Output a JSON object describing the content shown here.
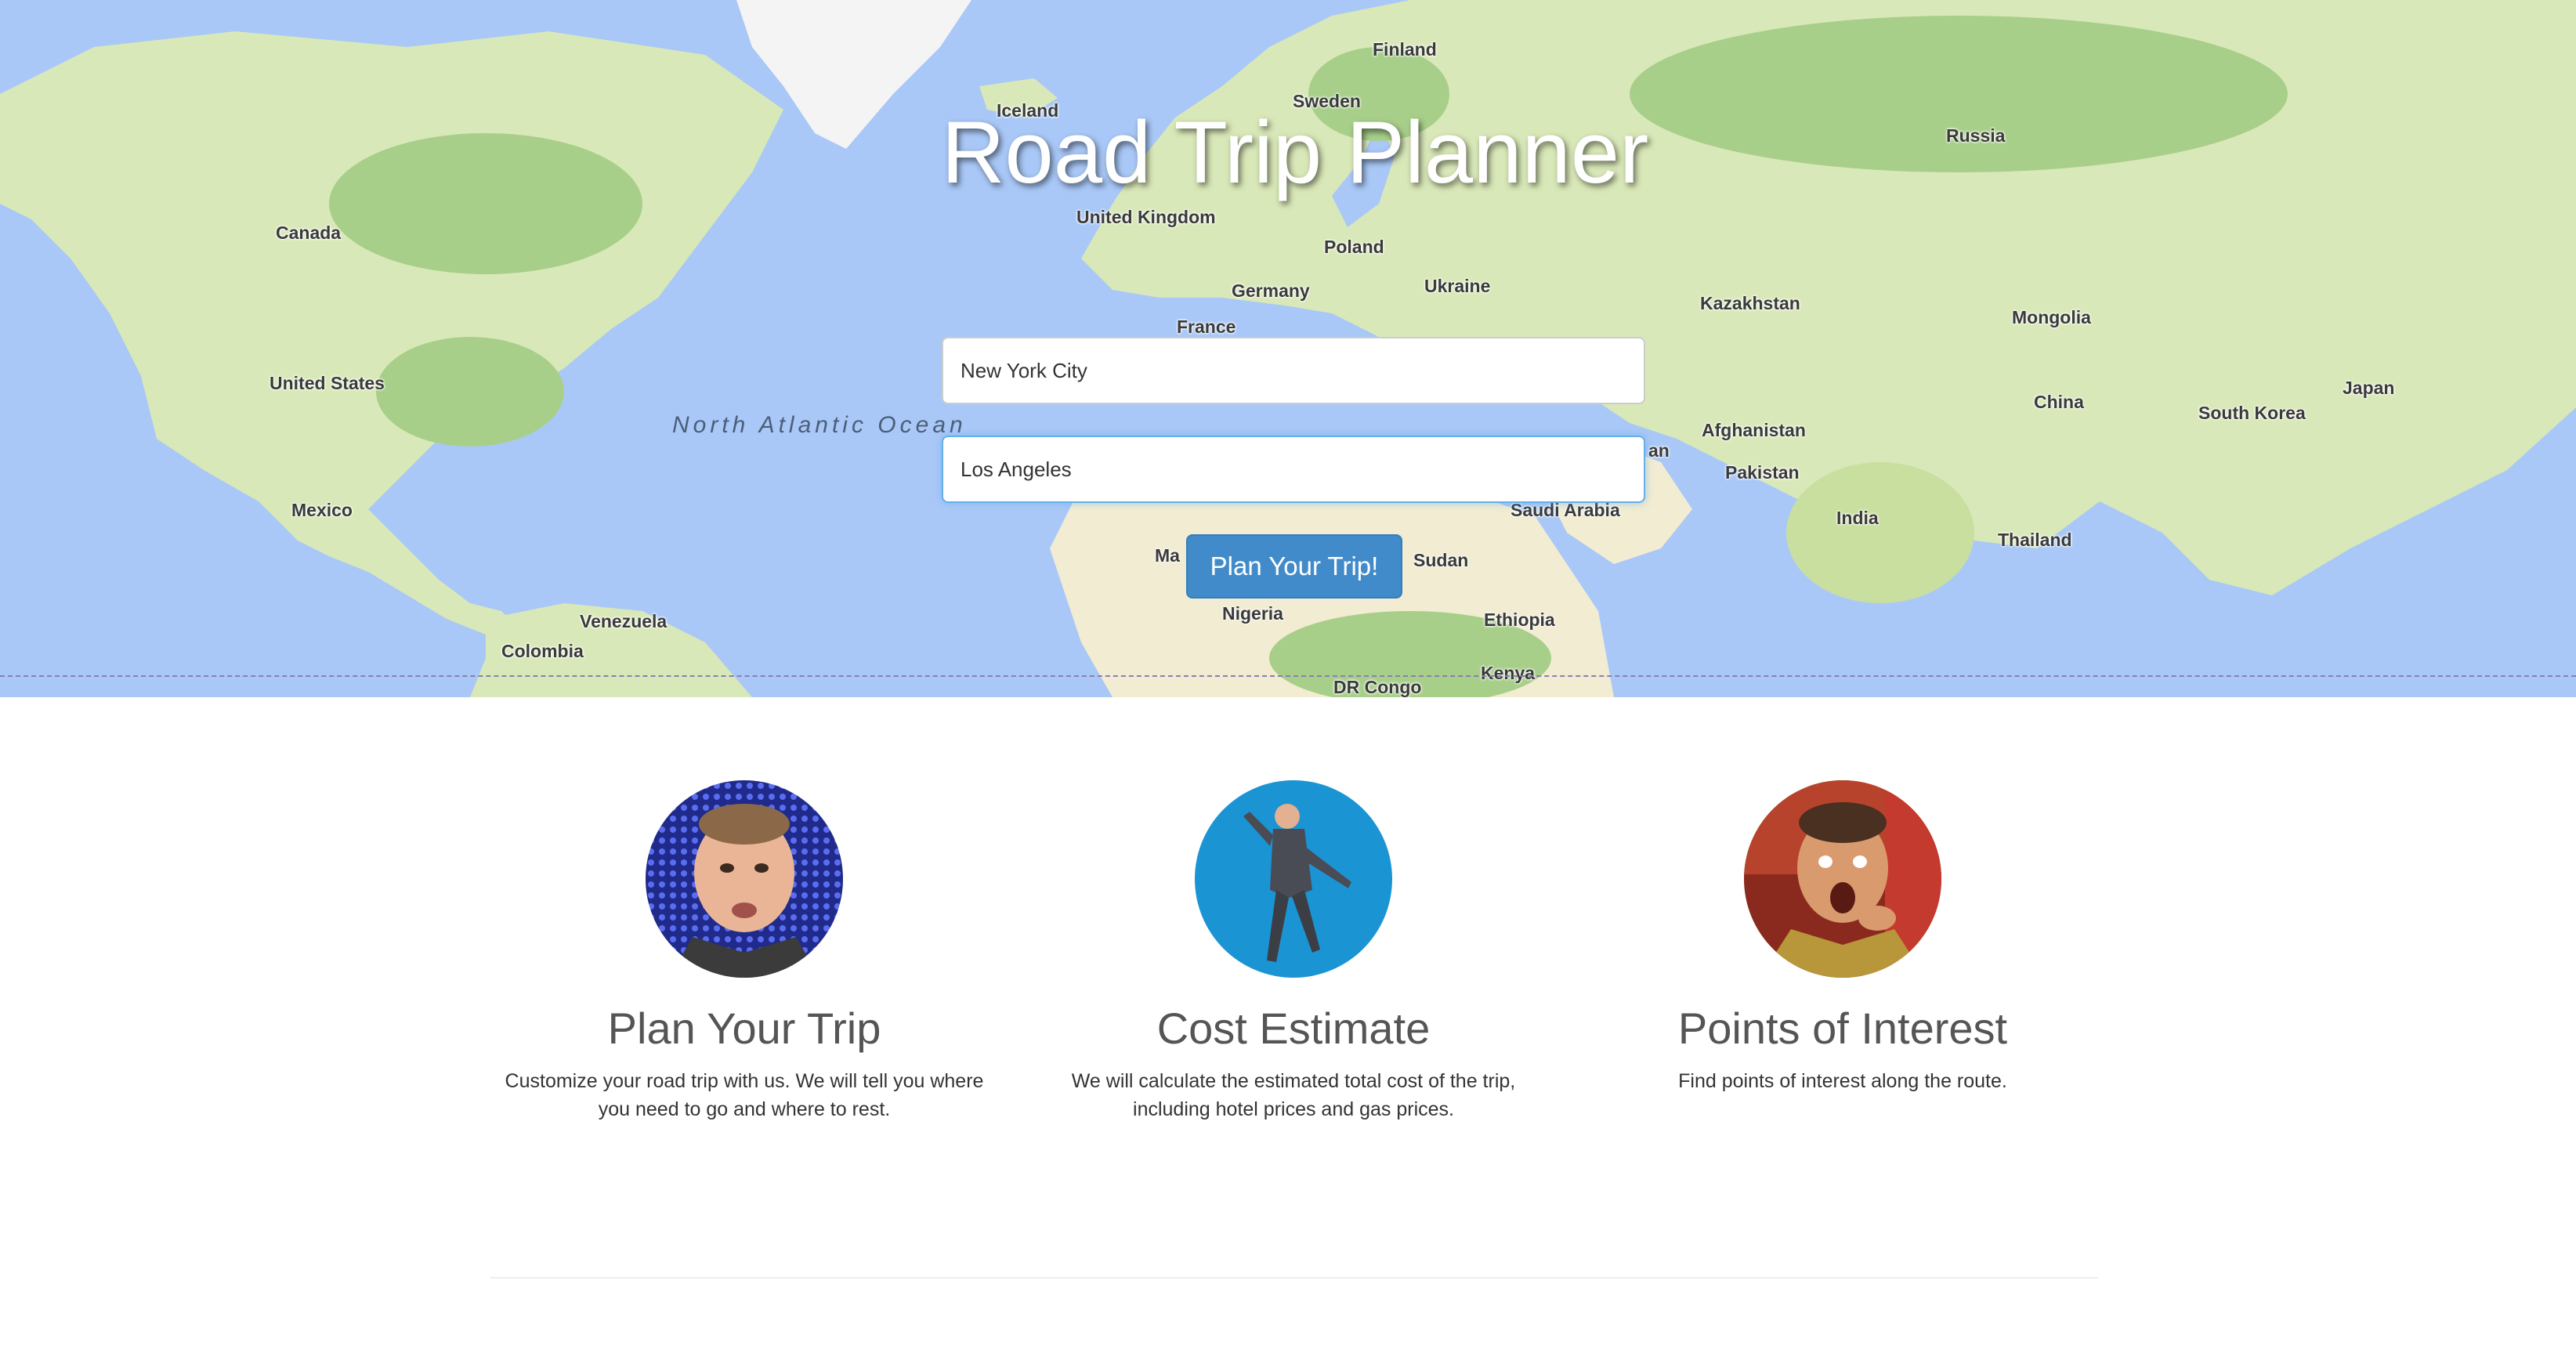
{
  "header": {
    "title": "Road Trip Planner"
  },
  "map": {
    "labels": {
      "finland": "Finland",
      "sweden": "Sweden",
      "iceland": "Iceland",
      "russia": "Russia",
      "united_kingdom": "United Kingdom",
      "canada": "Canada",
      "poland": "Poland",
      "germany": "Germany",
      "ukraine": "Ukraine",
      "france": "France",
      "kazakhstan": "Kazakhstan",
      "mongolia": "Mongolia",
      "united_states": "United States",
      "north_atlantic_ocean": "North Atlantic Ocean",
      "china": "China",
      "japan": "Japan",
      "south_korea": "South Korea",
      "afghanistan": "Afghanistan",
      "iran_fragment": "an",
      "pakistan": "Pakistan",
      "saudi_arabia": "Saudi Arabia",
      "india": "India",
      "mexico": "Mexico",
      "mali_fragment": "Ma",
      "sudan": "Sudan",
      "thailand": "Thailand",
      "nigeria": "Nigeria",
      "ethiopia": "Ethiopia",
      "venezuela": "Venezuela",
      "colombia": "Colombia",
      "kenya": "Kenya",
      "dr_congo": "DR Congo"
    }
  },
  "form": {
    "origin_value": "New York City",
    "destination_value": "Los Angeles",
    "submit_label": "Plan Your Trip!"
  },
  "features": [
    {
      "title": "Plan Your Trip",
      "description": "Customize your road trip with us. We will tell you where you need to go and where to rest."
    },
    {
      "title": "Cost Estimate",
      "description": "We will calculate the estimated total cost of the trip, including hotel prices and gas prices."
    },
    {
      "title": "Points of Interest",
      "description": "Find points of interest along the route."
    }
  ],
  "colors": {
    "ocean": "#a9c8f7",
    "land": "#d9e8b8",
    "forest": "#a8cf8a",
    "desert": "#f1ecd2",
    "ice": "#f4f4f4",
    "button": "#428bca",
    "title_text": "#ffffff",
    "feature_heading": "#555555"
  }
}
